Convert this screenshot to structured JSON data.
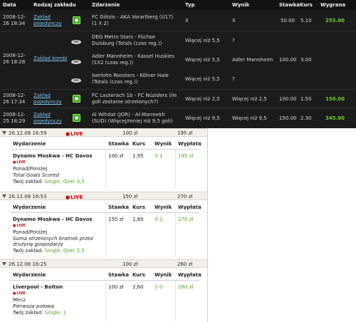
{
  "history": {
    "headers": {
      "date": "Data",
      "type": "Rodzaj zakładu",
      "event": "Zdarzenie",
      "bet": "Typ",
      "result": "Wynik",
      "stake": "Stawka",
      "odds": "Kurs",
      "win": "Wygrana"
    },
    "row1": {
      "date1": "2008-12-",
      "date2": "26 18:34",
      "type1": "Zakład",
      "type2": "pojedynczy",
      "event1": "FC Götzis - AKA Vorarlberg (U17)",
      "event2": "(1 X 2)",
      "bet": "X",
      "result": "X",
      "stake": "50.00",
      "odds": "5.10",
      "win": "255.00"
    },
    "row2": {
      "date1": "2008-12-",
      "date2": "26 18:28",
      "type": "Zakład kombi",
      "legs": [
        {
          "event1": "DEG Metro Stars - Füchse",
          "event2": "Duisburg (Totals (czas reg.))",
          "bet": "Więcej niż 5,5",
          "result": "?"
        },
        {
          "event1": "Adler Mannheim - Kassel Huskies",
          "event2": "(1X2 (czas reg.))",
          "bet": "Więcej niż 5,5",
          "result": "Adler Mannheim"
        },
        {
          "event1": "Iserlohn Roosters - Kölner Haie",
          "event2": "(Totals (czas reg.))",
          "bet": "Więcej niż 5,5",
          "result": "?"
        }
      ],
      "stake": "100.00",
      "odds": "3.00"
    },
    "row3": {
      "date1": "2008-12-",
      "date2": "26 17:34",
      "type1": "Zakład",
      "type2": "pojedynczy",
      "event1": "FC Lauterach 1b - FC Nüziders (Ile",
      "event2": "goli zostanie strzelonych?)",
      "bet": "Więcej niż 2,5",
      "result": "Więcej niż 2,5",
      "stake": "100.00",
      "odds": "1.50",
      "win": "150.00"
    },
    "row4": {
      "date1": "2008-12-",
      "date2": "25 18:29",
      "type1": "Zakład",
      "type2": "pojedynczy",
      "event1": "Al Wihdat (JOR) - Al-Marreekh",
      "event2": "(SUD) (Więcej/mniej niż 9,5 goli)",
      "bet": "Więcej niż 9,5",
      "result": "Więcej niż 9,5",
      "stake": "150.00",
      "odds": "2.30",
      "win": "345.00"
    }
  },
  "coupons": [
    {
      "datetime": "26.12.08 16:59",
      "live": "LIVE",
      "amount": "100 zł",
      "payout": "195 zł",
      "headers": {
        "event": "Wydarzenie",
        "stake": "Stawka",
        "odds": "Kurs",
        "result": "Wynik",
        "payout": "Wypłata"
      },
      "match": "Dynamo Moskwa - HC Davos",
      "stake": "100 zł",
      "odds": "1,95",
      "result": "3-1",
      "payout_row": "195 zł",
      "market": "Ponad/Poniżej",
      "desc1": "Total Goals Scored",
      "desc2": "",
      "choice_label": "Twój zakład:",
      "choice": "Single, Over 3,5"
    },
    {
      "datetime": "26.12.08 16:53",
      "live": "LIVE",
      "amount": "150 zł",
      "payout": "270 zł",
      "headers": {
        "event": "Wydarzenie",
        "stake": "Stawka",
        "odds": "Kurs",
        "result": "Wynik",
        "payout": "Wypłata"
      },
      "match": "Dynamo Moskwa - HC Davos",
      "stake": "150 zł",
      "odds": "1,80",
      "result": "3-1",
      "payout_row": "270 zł",
      "market": "Ponad/Poniżej",
      "desc1": "Suma strzelonych bramek przez",
      "desc2": "drużynę gospodarzy",
      "choice_label": "Twój zakład:",
      "choice": "Single, Over 2,5"
    },
    {
      "datetime": "26.12.08 16:25",
      "live": "",
      "amount": "100 zł",
      "payout": "260 zł",
      "headers": {
        "event": "Wydarzenie",
        "stake": "Stawka",
        "odds": "Kurs",
        "result": "Wynik",
        "payout": "Wypłata"
      },
      "match": "Liverpool - Bolton",
      "stake": "100 zł",
      "odds": "2,60",
      "result": "1-0",
      "payout_row": "260 zł",
      "market": "Mecz",
      "desc1": "Pierwsza połowa",
      "desc2": "",
      "choice_label": "Twój zakład:",
      "choice": "Single, 1"
    }
  ]
}
